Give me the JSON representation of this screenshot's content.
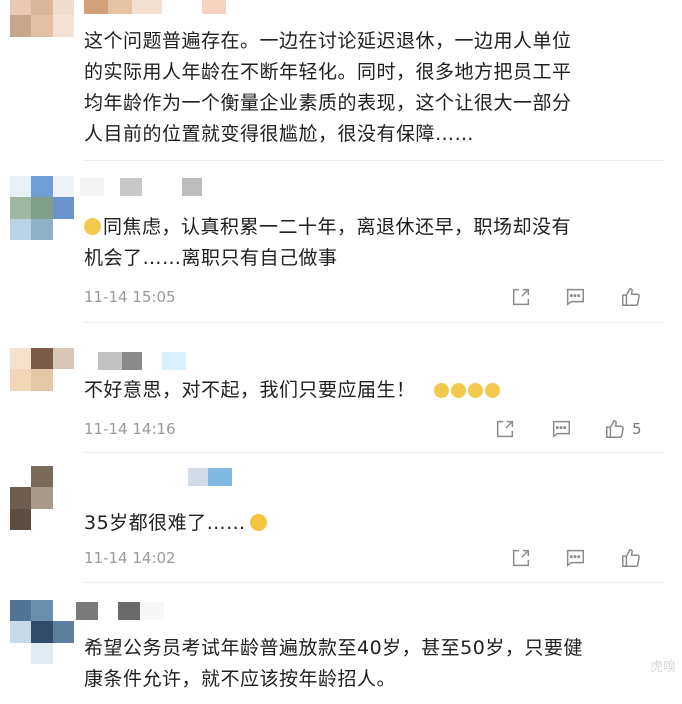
{
  "comments": [
    {
      "text": "这个问题普遍存在。一边在讨论延迟退休，一边用人单位的实际用人年龄在不断年轻化。同时，很多地方把员工平均年龄作为一个衡量企业素质的表现，这个让很大一部分人目前的位置就变得很尴尬，很没有保障……",
      "lines": [
        "这个问题普遍存在。一边在讨论延迟退休，一边用人单位",
        "的实际用人年龄在不断年轻化。同时，很多地方把员工平",
        "均年龄作为一个衡量企业素质的表现，这个让很大一部分",
        "人目前的位置就变得很尴尬，很没有保障……"
      ]
    },
    {
      "lines": [
        "同焦虑，认真积累一二十年，离退休还早，职场却没有",
        "机会了……离职只有自己做事"
      ],
      "time": "11-14 15:05",
      "like_count": ""
    },
    {
      "lines": [
        "不好意思，对不起，我们只要应届生！"
      ],
      "time": "11-14 14:16",
      "like_count": "5"
    },
    {
      "lines": [
        "35岁都很难了……"
      ],
      "time": "11-14 14:02",
      "like_count": ""
    },
    {
      "lines": [
        "希望公务员考试年龄普遍放款至40岁，甚至50岁，只要健",
        "康条件允许，就不应该按年龄招人。"
      ]
    }
  ],
  "icons": {
    "share": "share-icon",
    "reply": "comment-icon",
    "like": "thumbs-up-icon",
    "emoji": "emoji-icon"
  },
  "colors": {
    "text": "#1f1f1f",
    "meta": "#9a9a9a",
    "icon": "#8a8a8a",
    "divider": "#eeeeee"
  },
  "watermark": "虎嗅"
}
